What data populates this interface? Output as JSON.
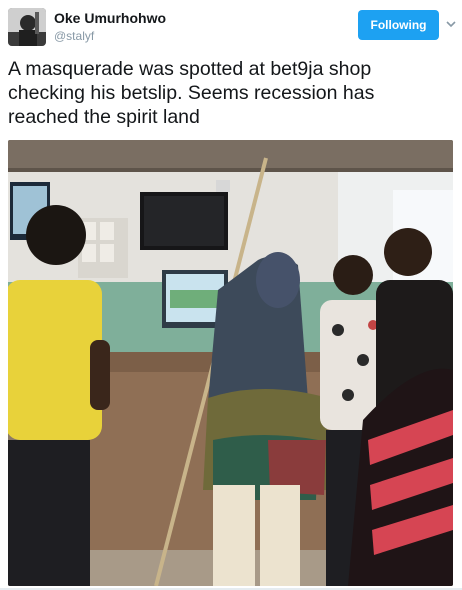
{
  "user": {
    "display_name": "Oke Umurhohwo",
    "handle": "@stalyf",
    "avatar_icon": "user-avatar"
  },
  "follow_button": {
    "label": "Following",
    "color": "#1da1f2"
  },
  "tweet": {
    "text": "A masquerade was spotted at bet9ja shop checking his betslip. Seems recession has reached the spirit land"
  },
  "media": {
    "type": "photo",
    "icon": "photo-icon"
  },
  "menu_icon": "chevron-down-icon"
}
